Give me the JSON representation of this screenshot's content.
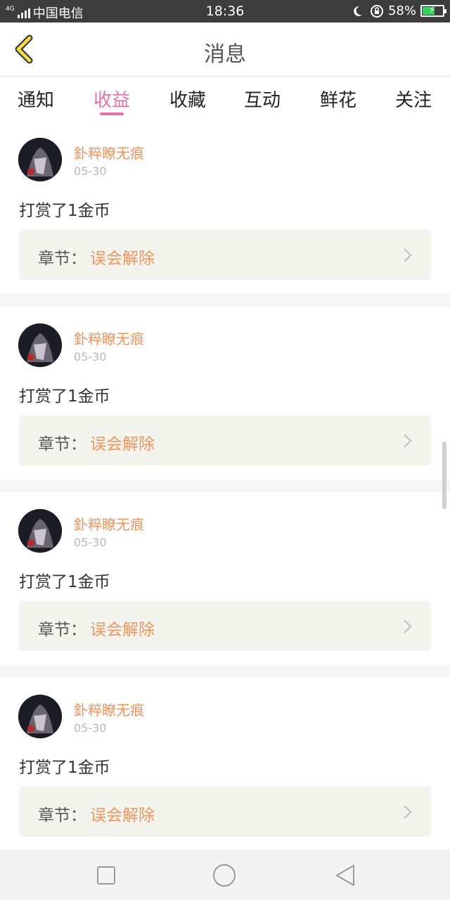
{
  "status_bar": {
    "network_tag": "4G",
    "carrier": "中国电信",
    "time": "18:36",
    "battery_percent": "58%",
    "icons": [
      "signal-icon",
      "moon-icon",
      "lock-rotation-icon",
      "battery-charging-icon"
    ]
  },
  "header": {
    "title": "消息",
    "back_icon": "chevron-left-icon"
  },
  "tabs": [
    {
      "label": "通知",
      "active": false
    },
    {
      "label": "收益",
      "active": true
    },
    {
      "label": "收藏",
      "active": false
    },
    {
      "label": "互动",
      "active": false
    },
    {
      "label": "鲜花",
      "active": false
    },
    {
      "label": "关注",
      "active": false
    }
  ],
  "colors": {
    "accent_pink": "#e772a8",
    "accent_orange": "#f0955f"
  },
  "messages": [
    {
      "username": "釙粹瞭无痕",
      "date": "05-30",
      "text": "打赏了1金币",
      "chapter_label": "章节：",
      "chapter_name": "误会解除"
    },
    {
      "username": "釙粹瞭无痕",
      "date": "05-30",
      "text": "打赏了1金币",
      "chapter_label": "章节：",
      "chapter_name": "误会解除"
    },
    {
      "username": "釙粹瞭无痕",
      "date": "05-30",
      "text": "打赏了1金币",
      "chapter_label": "章节：",
      "chapter_name": "误会解除"
    },
    {
      "username": "釙粹瞭无痕",
      "date": "05-30",
      "text": "打赏了1金币",
      "chapter_label": "章节：",
      "chapter_name": "误会解除"
    }
  ],
  "nav_bar": {
    "icons": [
      "square-icon",
      "circle-icon",
      "triangle-back-icon"
    ]
  }
}
